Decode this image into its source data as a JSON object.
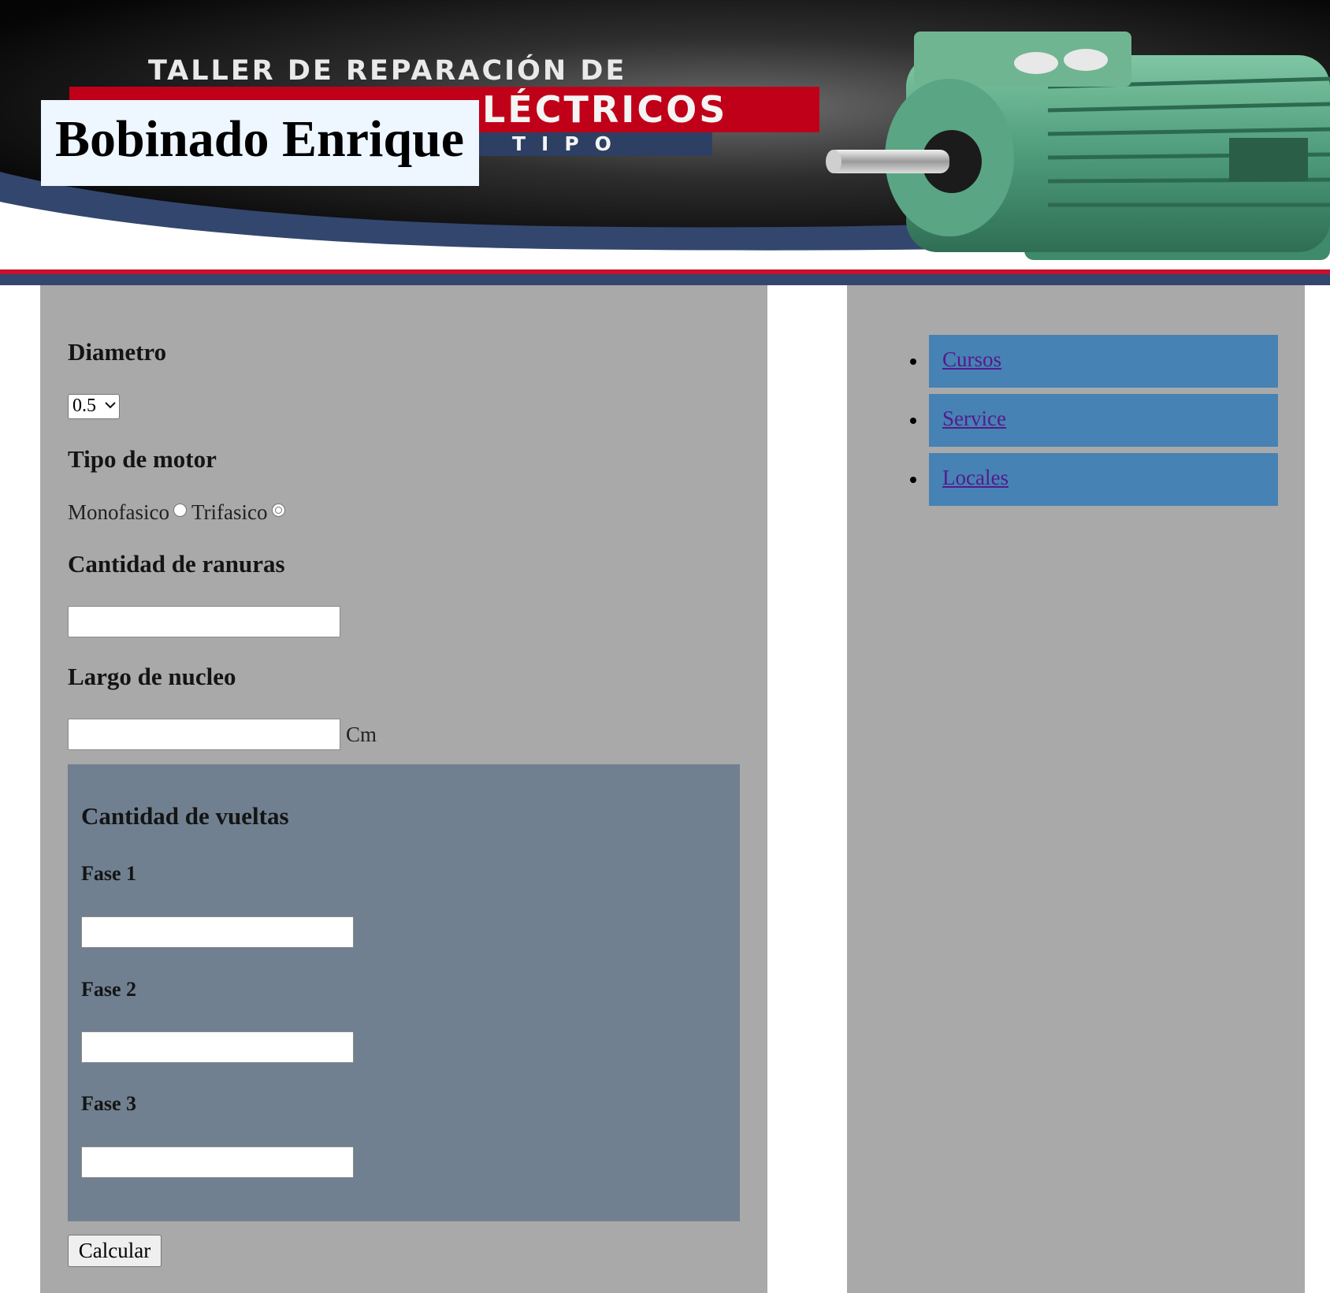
{
  "header": {
    "site_title": "Bobinado Enrique",
    "banner_line1": "TALLER DE REPARACIÓN DE",
    "banner_line2": "LÉCTRICOS",
    "banner_line3": "TIPO"
  },
  "form": {
    "diameter_label": "Diametro",
    "diameter_value": "0.5",
    "motor_type_label": "Tipo de motor",
    "motor_options": [
      "Monofasico",
      "Trifasico"
    ],
    "slots_label": "Cantidad de ranuras",
    "slots_value": "",
    "core_length_label": "Largo de nucleo",
    "core_length_value": "",
    "core_length_unit": "Cm",
    "turns_title": "Cantidad de vueltas",
    "phases": [
      {
        "label": "Fase 1",
        "value": ""
      },
      {
        "label": "Fase 2",
        "value": ""
      },
      {
        "label": "Fase 3",
        "value": ""
      }
    ],
    "submit_label": "Calcular"
  },
  "nav": {
    "items": [
      {
        "label": "Cursos"
      },
      {
        "label": "Service"
      },
      {
        "label": "Locales"
      }
    ]
  },
  "colors": {
    "panel_bg": "#a9a9a9",
    "turns_bg": "#708090",
    "nav_bg": "#4682b4",
    "link": "#551a8b",
    "banner_red": "#c00018",
    "banner_navy": "#2d3f62",
    "motor_green": "#5aa584"
  },
  "icons": [
    "chevron-down-icon",
    "electric-motor-illustration"
  ]
}
